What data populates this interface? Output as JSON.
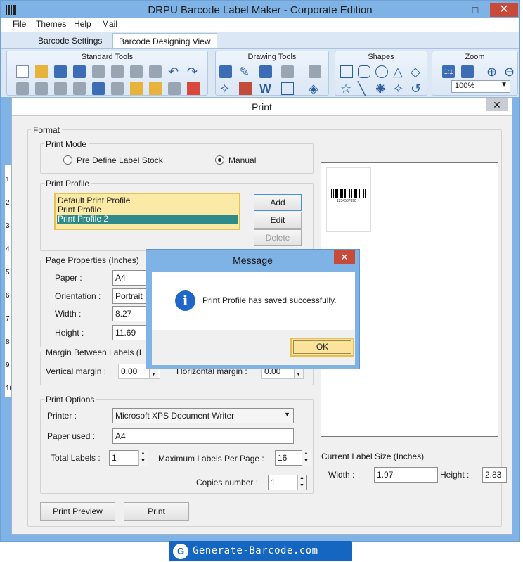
{
  "window": {
    "title": "DRPU Barcode Label Maker - Corporate Edition",
    "min": "–",
    "max": "□",
    "close": "✕"
  },
  "menu": [
    "File",
    "Themes",
    "Help",
    "Mail"
  ],
  "tabs": [
    "Barcode Settings",
    "Barcode Designing View"
  ],
  "ribbon": {
    "groups": [
      "Standard Tools",
      "Drawing Tools",
      "Shapes",
      "Zoom"
    ],
    "zoom_value": "100%",
    "zoom_button": "1:1"
  },
  "ruler": [
    "1",
    "2",
    "3",
    "4",
    "5",
    "6",
    "7",
    "8",
    "9",
    "10"
  ],
  "print_dialog": {
    "title": "Print",
    "close": "✕",
    "format_legend": "Format",
    "print_mode_legend": "Print Mode",
    "mode_predefine": "Pre Define Label Stock",
    "mode_manual": "Manual",
    "print_profile_legend": "Print Profile",
    "profiles": [
      "Default Print Profile",
      "Print Profile",
      "Print Profile 2"
    ],
    "add": "Add",
    "edit": "Edit",
    "delete": "Delete",
    "page_props_legend": "Page Properties (Inches)",
    "paper_label": "Paper :",
    "paper_value": "A4",
    "orientation_label": "Orientation :",
    "orientation_value": "Portrait",
    "width_label": "Width :",
    "width_value": "8.27",
    "height_label": "Height :",
    "height_value": "11.69",
    "margin_legend": "Margin Between Labels (I",
    "vertical_margin_label": "Vertical margin :",
    "vertical_margin_value": "0.00",
    "horizontal_margin_label": "Horizontal margin :",
    "horizontal_margin_value": "0.00",
    "print_options_legend": "Print Options",
    "printer_label": "Printer :",
    "printer_value": "Microsoft XPS Document Writer",
    "paper_used_label": "Paper used :",
    "paper_used_value": "A4",
    "total_labels_label": "Total Labels :",
    "total_labels_value": "1",
    "max_labels_label": "Maximum Labels Per Page :",
    "max_labels_value": "16",
    "copies_label": "Copies number :",
    "copies_value": "1",
    "print_preview": "Print Preview",
    "print": "Print",
    "barcode_text": "1234567890",
    "label_size_legend": "Current Label Size (Inches)",
    "label_width_label": "Width :",
    "label_width_value": "1.97",
    "label_height_label": "Height :",
    "label_height_value": "2.83"
  },
  "message": {
    "title": "Message",
    "close": "✕",
    "text": "Print Profile has saved successfully.",
    "ok": "OK",
    "icon": "i"
  },
  "banner": {
    "text": "Generate-Barcode.com",
    "logo": "G"
  }
}
